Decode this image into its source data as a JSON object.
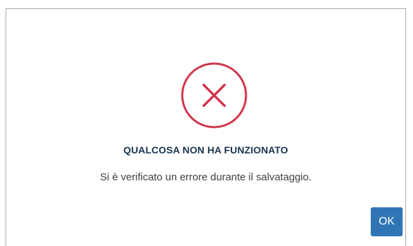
{
  "dialog": {
    "icon": "error-circle-x-icon",
    "title": "QUALCOSA NON HA FUNZIONATO",
    "message": "Si è verificato un errore durante il salvataggio.",
    "ok_label": "OK"
  },
  "colors": {
    "error": "#d1344c",
    "title_text": "#17324d",
    "message_text": "#3a3f44",
    "primary_button": "#2f75b5",
    "border": "#a9a9a9"
  }
}
